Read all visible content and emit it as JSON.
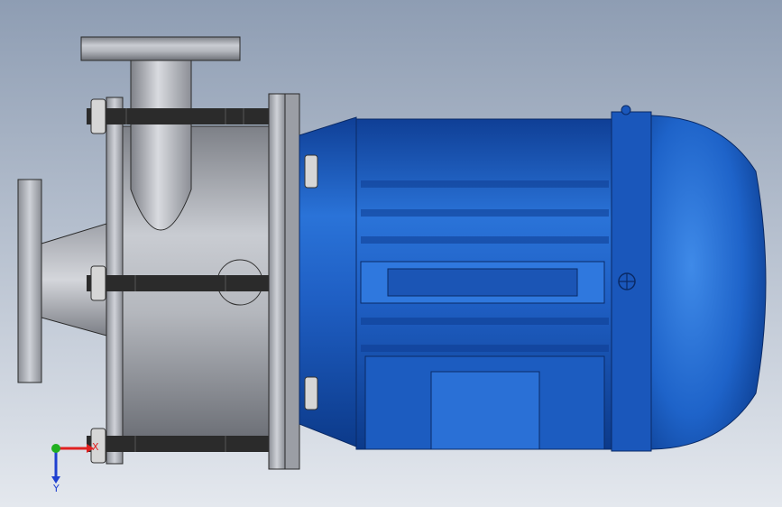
{
  "viewport": {
    "background_top": "#8e9db3",
    "background_bottom": "#e4e8ee"
  },
  "model": {
    "pump_casing_color": "#a9adb4",
    "flange_color": "#9fa3aa",
    "motor_color": "#1d5fc2",
    "motor_highlight": "#4f92e8",
    "bolt_color": "#2b2b2b",
    "nut_color": "#d6d6d6"
  },
  "triad": {
    "x_axis_label": "X",
    "y_axis_label": "Y",
    "x_color": "#e02020",
    "y_color": "#1f40d0",
    "z_color": "#20b020"
  }
}
